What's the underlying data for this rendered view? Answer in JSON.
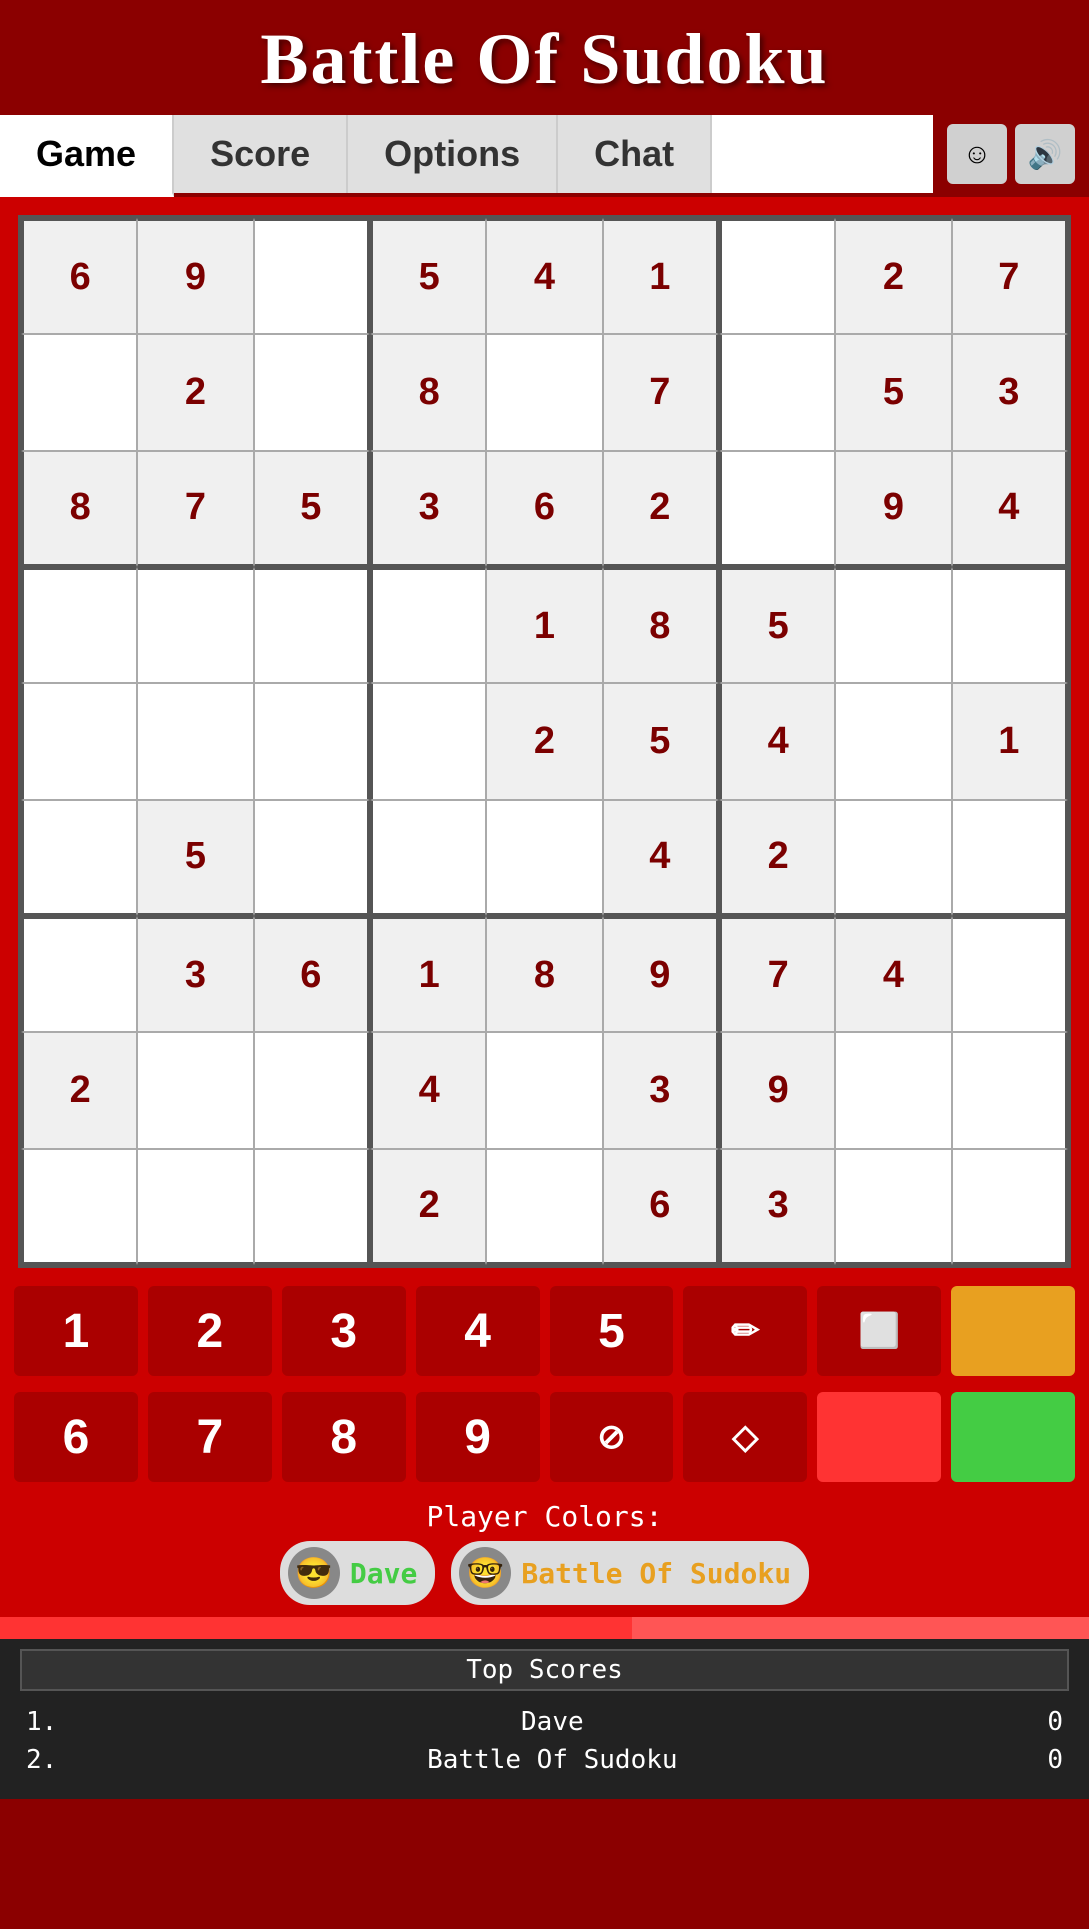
{
  "header": {
    "title": "Battle Of Sudoku"
  },
  "nav": {
    "tabs": [
      {
        "label": "Game",
        "active": true
      },
      {
        "label": "Score",
        "active": false
      },
      {
        "label": "Options",
        "active": false
      },
      {
        "label": "Chat",
        "active": false
      }
    ],
    "smiley_icon": "☺",
    "sound_icon": "🔊"
  },
  "sudoku": {
    "grid": [
      [
        "6",
        "9",
        "",
        "5",
        "4",
        "1",
        "",
        "2",
        "7"
      ],
      [
        "",
        "2",
        "",
        "8",
        "",
        "7",
        "",
        "5",
        "3"
      ],
      [
        "8",
        "7",
        "5",
        "3",
        "6",
        "2",
        "",
        "9",
        "4"
      ],
      [
        "",
        "",
        "",
        "",
        "1",
        "8",
        "5",
        "",
        ""
      ],
      [
        "",
        "",
        "",
        "",
        "2",
        "5",
        "4",
        "",
        "1"
      ],
      [
        "",
        "5",
        "",
        "",
        "",
        "4",
        "2",
        "",
        ""
      ],
      [
        "",
        "3",
        "6",
        "1",
        "8",
        "9",
        "7",
        "4",
        ""
      ],
      [
        "2",
        "",
        "",
        "4",
        "",
        "3",
        "9",
        "",
        ""
      ],
      [
        "",
        "",
        "",
        "2",
        "",
        "6",
        "3",
        "",
        ""
      ]
    ]
  },
  "numpad": {
    "row1": [
      "1",
      "2",
      "3",
      "4",
      "5"
    ],
    "row1_icons": [
      "pencil",
      "square"
    ],
    "row1_color": "orange",
    "row2": [
      "6",
      "7",
      "8",
      "9"
    ],
    "row2_icons": [
      "no",
      "fill"
    ],
    "row2_color_black": "black",
    "row2_color_green": "green"
  },
  "player_colors": {
    "label": "Player Colors:",
    "players": [
      {
        "name": "Dave",
        "color": "green",
        "avatar": "😎"
      },
      {
        "name": "Battle Of Sudoku",
        "color": "orange",
        "avatar": "🤓"
      }
    ]
  },
  "top_scores": {
    "title": "Top Scores",
    "scores": [
      {
        "rank": "1.",
        "name": "Dave",
        "score": "0"
      },
      {
        "rank": "2.",
        "name": "Battle Of Sudoku",
        "score": "0"
      }
    ]
  }
}
